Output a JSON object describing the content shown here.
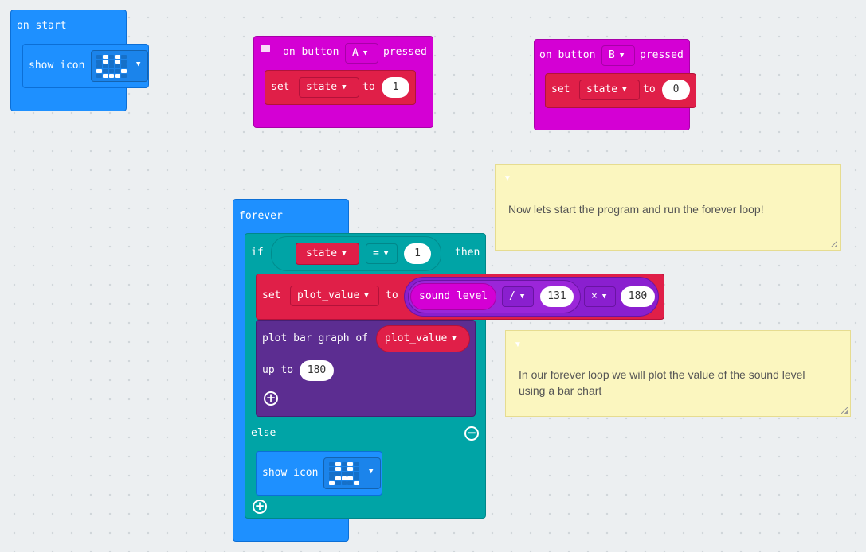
{
  "on_start": {
    "header": "on start",
    "show_icon_label": "show icon"
  },
  "button_a": {
    "on_label": "on button",
    "button_value": "A",
    "pressed_label": "pressed",
    "set_label": "set",
    "variable": "state",
    "to_label": "to",
    "value": "1"
  },
  "button_b": {
    "on_label": "on button",
    "button_value": "B",
    "pressed_label": "pressed",
    "set_label": "set",
    "variable": "state",
    "to_label": "to",
    "value": "0"
  },
  "forever": {
    "header": "forever",
    "if_label": "if",
    "condition_variable": "state",
    "operator": "=",
    "condition_value": "1",
    "then_label": "then",
    "set_label": "set",
    "set_variable": "plot_value",
    "to_label": "to",
    "sound_level": "sound level",
    "divide_op": "/",
    "divisor": "131",
    "multiply_op": "×",
    "multiplier": "180",
    "plot_label": "plot bar graph of",
    "plot_variable": "plot_value",
    "up_to_label": "up to",
    "up_to_value": "180",
    "else_label": "else",
    "else_show_icon_label": "show icon"
  },
  "comments": {
    "note1": "Now lets start the program and run the forever loop!",
    "note2": "In our forever loop we will plot the value of the sound level using a bar chart"
  },
  "icons": {
    "comment_icon": "comment-icon",
    "dropdown": "caret-down-icon",
    "add": "plus-circle-icon",
    "remove": "minus-circle-icon",
    "led_grid": "led-matrix-icon"
  },
  "colors": {
    "events": "#d400d4",
    "basic": "#1e90ff",
    "logic": "#00a4a6",
    "variables": "#e01f48",
    "led": "#5c2d91",
    "math": "#8a1fcf",
    "note_bg": "#fbf6bf"
  }
}
